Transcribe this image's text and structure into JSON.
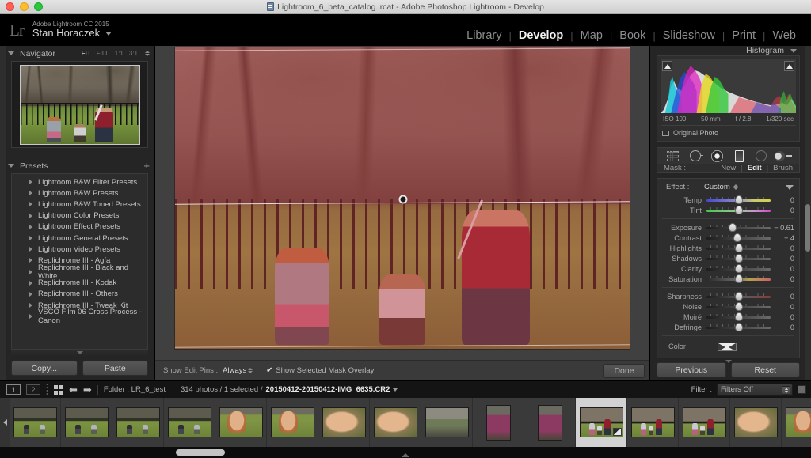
{
  "window": {
    "title": "Lightroom_6_beta_catalog.lrcat - Adobe Photoshop Lightroom - Develop",
    "catalog_icon": "catalog-icon"
  },
  "identity": {
    "logo": "Lr",
    "product": "Adobe Lightroom CC 2015",
    "user": "Stan Horaczek"
  },
  "modules": [
    {
      "label": "Library",
      "active": false
    },
    {
      "label": "Develop",
      "active": true
    },
    {
      "label": "Map",
      "active": false
    },
    {
      "label": "Book",
      "active": false
    },
    {
      "label": "Slideshow",
      "active": false
    },
    {
      "label": "Print",
      "active": false
    },
    {
      "label": "Web",
      "active": false
    }
  ],
  "navigator": {
    "title": "Navigator",
    "zoom_levels": [
      {
        "label": "FIT",
        "active": true
      },
      {
        "label": "FILL",
        "active": false
      },
      {
        "label": "1:1",
        "active": false
      },
      {
        "label": "3:1",
        "active": false
      }
    ]
  },
  "presets": {
    "title": "Presets",
    "add_label": "+",
    "items": [
      "Lightroom B&W Filter Presets",
      "Lightroom B&W Presets",
      "Lightroom B&W Toned Presets",
      "Lightroom Color Presets",
      "Lightroom Effect Presets",
      "Lightroom General Presets",
      "Lightroom Video Presets",
      "Replichrome III - Agfa",
      "Replichrome III - Black and White",
      "Replichrome III - Kodak",
      "Replichrome III - Others",
      "Replichrome III - Tweak Kit",
      "VSCO Film 06 Cross Process - Canon"
    ],
    "copy_label": "Copy...",
    "paste_label": "Paste"
  },
  "histogram": {
    "title": "Histogram",
    "iso": "ISO 100",
    "focal": "50 mm",
    "aperture": "f / 2.8",
    "shutter": "1/320 sec",
    "original_photo_label": "Original Photo"
  },
  "tools": [
    {
      "name": "crop-overlay-tool",
      "active": false
    },
    {
      "name": "spot-removal-tool",
      "active": false
    },
    {
      "name": "radial-filter-tool",
      "active": true
    },
    {
      "name": "graduated-filter-tool",
      "active": false
    },
    {
      "name": "redeye-tool",
      "active": false
    },
    {
      "name": "adjustment-brush-tool",
      "active": false
    }
  ],
  "mask": {
    "label": "Mask :",
    "options": [
      {
        "label": "New",
        "active": false
      },
      {
        "label": "Edit",
        "active": true
      },
      {
        "label": "Brush",
        "active": false
      }
    ]
  },
  "effect": {
    "label": "Effect :",
    "value": "Custom",
    "sliders_white_balance": [
      {
        "label": "Temp",
        "value": "0",
        "knob": 50,
        "bar": "temp"
      },
      {
        "label": "Tint",
        "value": "0",
        "knob": 50,
        "bar": "tint"
      }
    ],
    "sliders_tone": [
      {
        "label": "Exposure",
        "value": "− 0.61",
        "knob": 41,
        "bar": "plain"
      },
      {
        "label": "Contrast",
        "value": "− 4",
        "knob": 48,
        "bar": "plain"
      },
      {
        "label": "Highlights",
        "value": "0",
        "knob": 50,
        "bar": "plain"
      },
      {
        "label": "Shadows",
        "value": "0",
        "knob": 50,
        "bar": "plain"
      },
      {
        "label": "Clarity",
        "value": "0",
        "knob": 50,
        "bar": "plain"
      },
      {
        "label": "Saturation",
        "value": "0",
        "knob": 50,
        "bar": "sat"
      }
    ],
    "sliders_detail": [
      {
        "label": "Sharpness",
        "value": "0",
        "knob": 50,
        "bar": "sharp"
      },
      {
        "label": "Noise",
        "value": "0",
        "knob": 50,
        "bar": "plain"
      },
      {
        "label": "Moiré",
        "value": "0",
        "knob": 50,
        "bar": "plain"
      },
      {
        "label": "Defringe",
        "value": "0",
        "knob": 50,
        "bar": "plain"
      }
    ],
    "color_label": "Color",
    "previous_label": "Previous",
    "reset_label": "Reset"
  },
  "view_toolbar": {
    "pins_label": "Show Edit Pins :",
    "pins_value": "Always",
    "overlay_checked": true,
    "overlay_check_glyph": "✔",
    "overlay_label": "Show Selected Mask Overlay",
    "done_label": "Done"
  },
  "filmstrip_bar": {
    "page1": "1",
    "page2": "2",
    "grid_icon": "grid-view-icon",
    "back_arrow": "⬅",
    "forward_arrow": "➡",
    "folder_label": "Folder : LR_6_test",
    "count_label": "314 photos / 1 selected /",
    "filename": "20150412-20150412-IMG_6635.CR2",
    "filter_label": "Filter :",
    "filter_value": "Filters Off"
  },
  "filmstrip": {
    "thumbs": [
      {
        "variant": "lawn",
        "orientation": "landscape",
        "selected": false
      },
      {
        "variant": "lawn",
        "orientation": "landscape",
        "selected": false
      },
      {
        "variant": "lawn",
        "orientation": "landscape",
        "selected": false
      },
      {
        "variant": "lawn",
        "orientation": "landscape",
        "selected": false
      },
      {
        "variant": "face",
        "orientation": "landscape",
        "selected": false
      },
      {
        "variant": "face",
        "orientation": "landscape",
        "selected": false
      },
      {
        "variant": "closeup",
        "orientation": "landscape",
        "selected": false
      },
      {
        "variant": "closeup",
        "orientation": "landscape",
        "selected": false
      },
      {
        "variant": "road",
        "orientation": "landscape",
        "selected": false
      },
      {
        "variant": "pink",
        "orientation": "portrait",
        "selected": false
      },
      {
        "variant": "pink",
        "orientation": "portrait",
        "selected": false
      },
      {
        "variant": "group",
        "orientation": "landscape",
        "selected": true
      },
      {
        "variant": "group",
        "orientation": "landscape",
        "selected": false
      },
      {
        "variant": "group",
        "orientation": "landscape",
        "selected": false
      },
      {
        "variant": "closeup",
        "orientation": "landscape",
        "selected": false
      },
      {
        "variant": "face",
        "orientation": "landscape",
        "selected": false
      },
      {
        "variant": "closeup",
        "orientation": "landscape",
        "selected": false
      }
    ]
  },
  "colors": {
    "panel_bg": "#252525",
    "canvas_bg": "#404040",
    "accent_text": "#f2f2f2",
    "mask_overlay": "#d23c46",
    "selected_thumb_bg": "#d2d2d2"
  }
}
